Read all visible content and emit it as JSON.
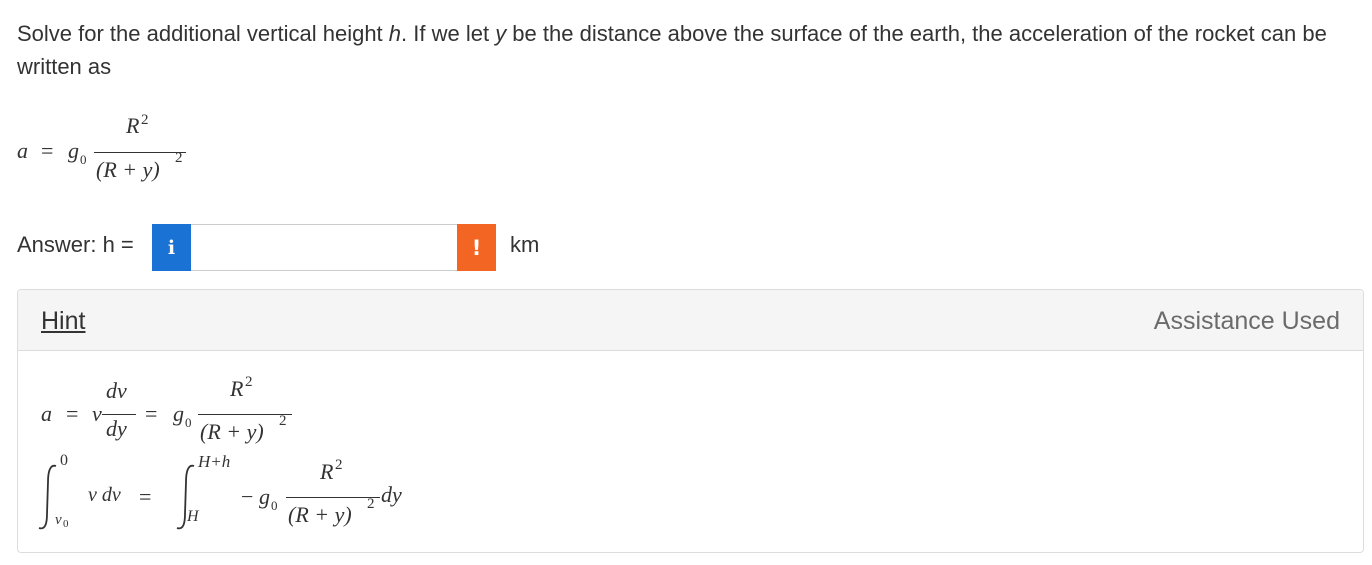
{
  "question": {
    "part1": "Solve for the additional vertical height ",
    "h_var": "h",
    "part2": ". If we let ",
    "y_var": "y",
    "part3": " be the distance above the surface of the earth, the acceleration of the rocket can be written as"
  },
  "equation1": {
    "lhs": "a",
    "eq": "=",
    "g": "g",
    "g_sub": "0",
    "num": "R",
    "num_exp": "2",
    "den": "(R + y)",
    "den_exp": "2"
  },
  "answer": {
    "label": "Answer: h =",
    "info_icon": "i",
    "value": "",
    "warning_icon": "!",
    "unit": "km"
  },
  "hint": {
    "link_label": "Hint",
    "assistance_label": "Assistance Used",
    "eq_a": {
      "lhs": "a",
      "eq1": "=",
      "v": "v",
      "num1": "dv",
      "den1": "dy",
      "eq2": "=",
      "g": "g",
      "g_sub": "0",
      "num2": "R",
      "num2_exp": "2",
      "den2": "(R + y)",
      "den2_exp": "2"
    },
    "eq_b": {
      "int1_upper": "0",
      "int1_lower": "v",
      "int1_lower_sub": "0",
      "integrand1": "v dv",
      "eq": "=",
      "int2_upper": "H+h",
      "int2_lower": "H",
      "minus": "−",
      "g": "g",
      "g_sub": "0",
      "num": "R",
      "num_exp": "2",
      "den": "(R + y)",
      "den_exp": "2",
      "dy": "dy"
    }
  }
}
